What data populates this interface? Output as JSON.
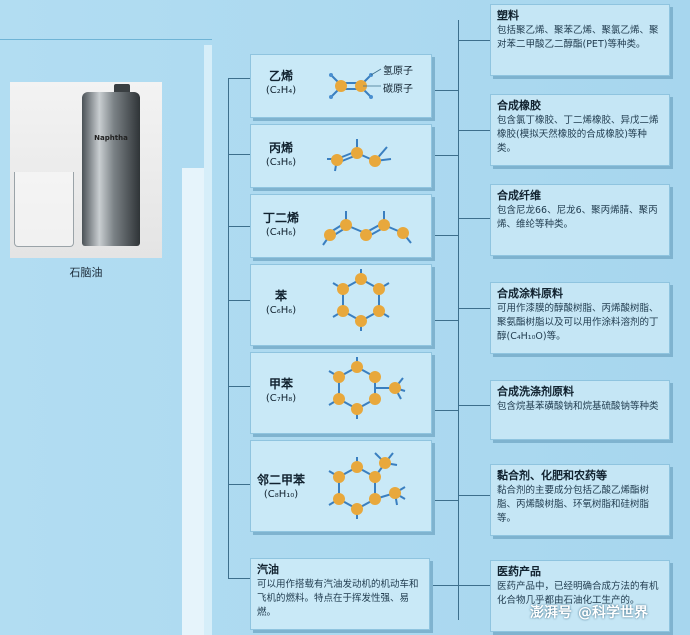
{
  "photo": {
    "label": "石脑油",
    "can_text": "Naphtha"
  },
  "molecules": [
    {
      "name": "乙烯",
      "formula": "(C₂H₄)",
      "legend_h": "氢原子",
      "legend_c": "碳原子"
    },
    {
      "name": "丙烯",
      "formula": "(C₃H₆)"
    },
    {
      "name": "丁二烯",
      "formula": "(C₄H₆)"
    },
    {
      "name": "苯",
      "formula": "(C₆H₆)"
    },
    {
      "name": "甲苯",
      "formula": "(C₇H₈)"
    },
    {
      "name": "邻二甲苯",
      "formula": "(C₈H₁₀)"
    }
  ],
  "gasoline": {
    "title": "汽油",
    "desc": "可以用作搭载有汽油发动机的机动车和飞机的燃料。特点在于挥发性强、易燃。"
  },
  "products": [
    {
      "title": "塑料",
      "desc": "包括聚乙烯、聚苯乙烯、聚氯乙烯、聚对苯二甲酸乙二醇酯(PET)等种类。"
    },
    {
      "title": "合成橡胶",
      "desc": "包含氯丁橡胶、丁二烯橡胶、异戊二烯橡胶(模拟天然橡胶的合成橡胶)等种类。"
    },
    {
      "title": "合成纤维",
      "desc": "包含尼龙66、尼龙6、聚丙烯腈、聚丙烯、维纶等种类。"
    },
    {
      "title": "合成涂料原料",
      "desc": "可用作漆膜的醇酸树脂、丙烯酸树脂、聚氨酯树脂以及可以用作涂料溶剂的丁醇(C₄H₁₀O)等。"
    },
    {
      "title": "合成洗涤剂原料",
      "desc": "包含烷基苯磺酸钠和烷基硫酸钠等种类"
    },
    {
      "title": "黏合剂、化肥和农药等",
      "desc": "黏合剂的主要成分包括乙酸乙烯酯树脂、丙烯酸树脂、环氧树脂和硅树脂等。"
    },
    {
      "title": "医药产品",
      "desc": "医药产品中，已经明确合成方法的有机化合物几乎都由石油化工生产的。"
    }
  ],
  "watermark": {
    "brand": "澎湃号",
    "account": "@科学世界"
  },
  "colors": {
    "carbon": "#e8a83c",
    "hydrogen": "#4a8fd0",
    "bond": "#3a7fc0"
  }
}
